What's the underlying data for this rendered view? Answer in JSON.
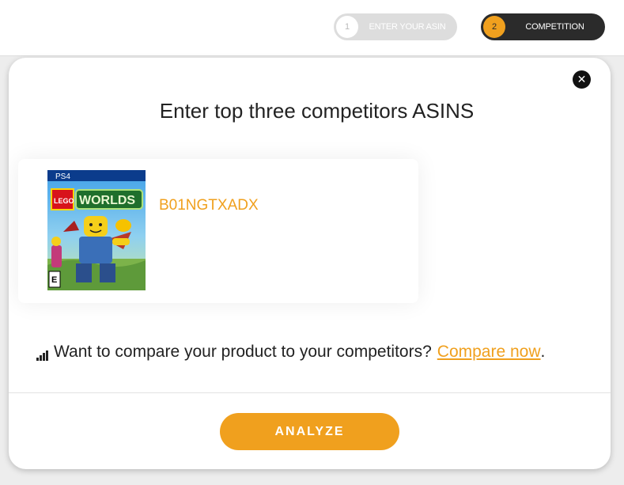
{
  "steps": [
    {
      "number": "1",
      "label": "ENTER YOUR ASIN",
      "state": "inactive"
    },
    {
      "number": "2",
      "label": "COMPETITION",
      "state": "active"
    }
  ],
  "modal": {
    "close_icon": "close-icon",
    "title": "Enter top three competitors ASINS",
    "competitors": [
      {
        "asin": "B01NGTXADX",
        "image": {
          "platform_label": "PS4",
          "brand_label": "LEGO",
          "game_title": "WORLDS",
          "rating_label": "E"
        }
      }
    ],
    "compare": {
      "icon": "signal-bars-icon",
      "text": "Want to compare your product to your competitors?",
      "link_label": "Compare now",
      "suffix": "."
    },
    "analyze_label": "ANALYZE"
  },
  "colors": {
    "accent": "#f0a01e",
    "dark": "#2b2b2b",
    "inactive_step": "#dddddd"
  }
}
